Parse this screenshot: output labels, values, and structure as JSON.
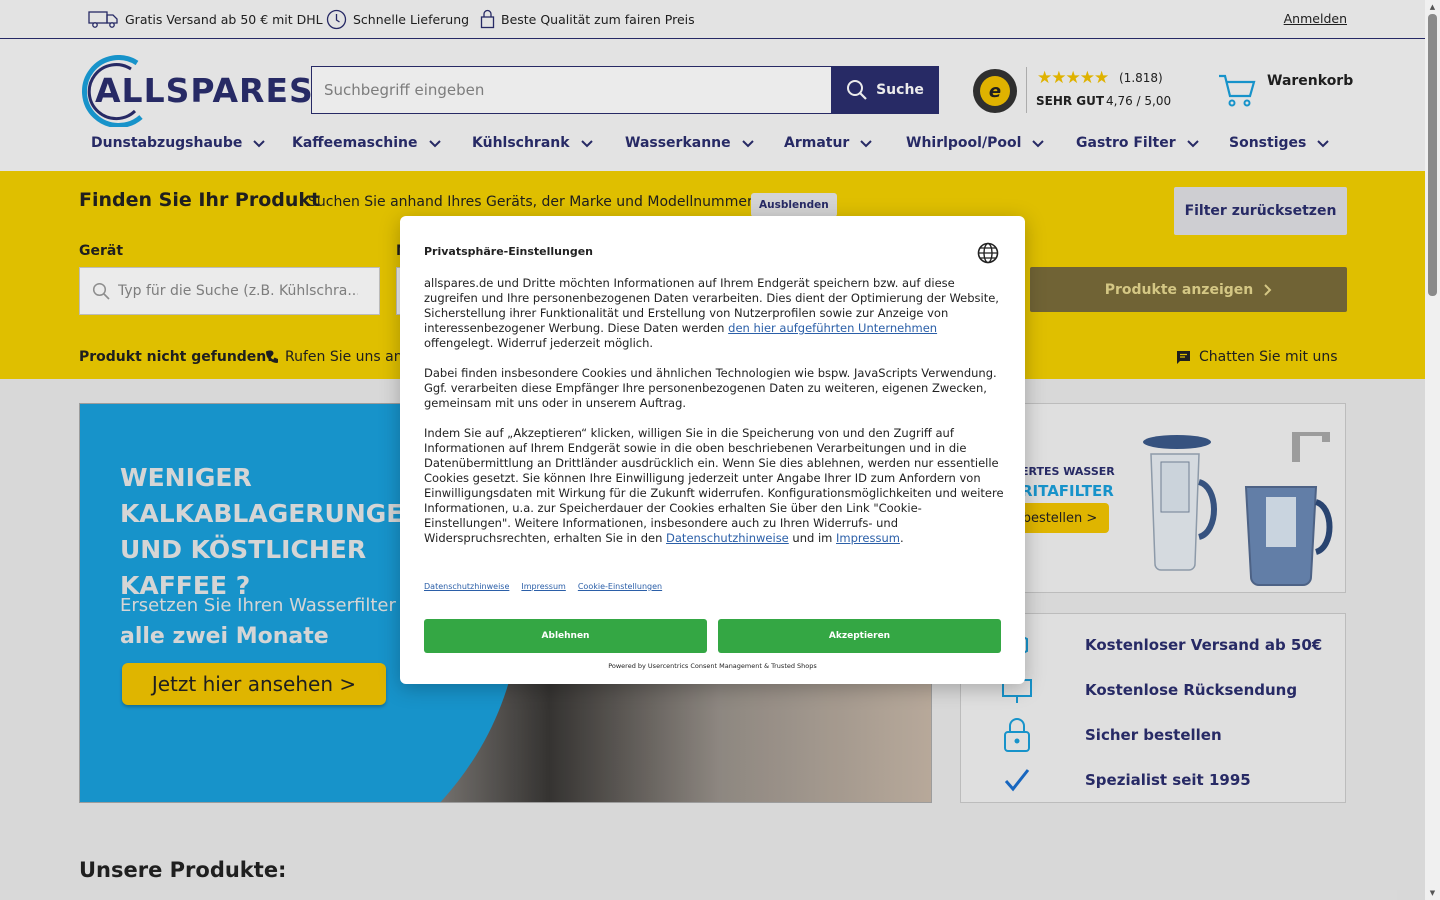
{
  "topbar": {
    "perks": [
      "Gratis Versand ab 50 € mit DHL",
      "Schnelle Lieferung",
      "Beste Qualität zum fairen Preis"
    ],
    "login": "Anmelden"
  },
  "header": {
    "logo": "ALLSPARES",
    "search_placeholder": "Suchbegriff eingeben",
    "search_button": "Suche",
    "trust": {
      "count": "(1.818)",
      "grade": "SEHR GUT",
      "score": "4,76 / 5,00",
      "rating_stars": 5
    },
    "cart": "Warenkorb"
  },
  "nav": [
    "Dunstabzugshaube",
    "Kaffeemaschine",
    "Kühlschrank",
    "Wasserkanne",
    "Armatur",
    "Whirlpool/Pool",
    "Gastro Filter",
    "Sonstiges"
  ],
  "finder": {
    "title": "Finden Sie Ihr Produkt",
    "subtitle": "Suchen Sie anhand Ihres Geräts, der Marke und Modellnummer",
    "hide": "Ausblenden",
    "reset": "Filter zurücksetzen",
    "device_label": "Gerät",
    "second_label": "M",
    "device_placeholder": "Typ für die Suche (z.B. Kühlschra...",
    "show_button": "Produkte anzeigen",
    "not_found": "Produkt nicht gefunden?",
    "call": "Rufen Sie uns an",
    "chat": "Chatten Sie mit uns"
  },
  "hero": {
    "headline": "WENIGER KALKABLAGERUNGEN UND KÖSTLICHER KAFFEE ?",
    "line2": "Ersetzen Sie Ihren Wasserfilter",
    "line3": "alle zwei Monate",
    "cta": "Jetzt hier ansehen >"
  },
  "promo": {
    "t1": "ERTES WASSER",
    "t2": "RITAFILTER",
    "button": "bestellen >"
  },
  "usp": [
    "Kostenloser Versand ab 50€",
    "Kostenlose Rücksendung",
    "Sicher bestellen",
    "Spezialist seit 1995"
  ],
  "products_title": "Unsere Produkte:",
  "consent": {
    "title": "Privatsphäre-Einstellungen",
    "p1_a": "allspares.de und Dritte möchten Informationen auf Ihrem Endgerät speichern bzw. auf diese zugreifen und Ihre personenbezogenen Daten verarbeiten. Dies dient der Optimierung der Website, Sicherstellung ihrer Funktionalität und Erstellung von Nutzerprofilen sowie zur Anzeige von interessenbezogener Werbung. Diese Daten werden ",
    "p1_link": "den hier aufgeführten Unternehmen",
    "p1_b": " offengelegt. Widerruf jederzeit möglich.",
    "p2": "Dabei finden insbesondere Cookies und ähnlichen Technologien wie bspw. JavaScripts Verwendung. Ggf. verarbeiten diese Empfänger Ihre personenbezogenen Daten zu weiteren, eigenen Zwecken, gemeinsam mit uns oder in unserem Auftrag.",
    "p3_a": "Indem Sie auf „Akzeptieren“ klicken, willigen Sie in die Speicherung von und den Zugriff auf Informationen auf Ihrem Endgerät sowie in die oben beschriebenen Verarbeitungen und in die Datenübermittlung an Drittländer ausdrücklich ein. Wenn Sie dies ablehnen, werden nur essentielle Cookies gesetzt. Sie können Ihre Einwilligung jederzeit unter Angabe Ihrer ID zum Anfordern von Einwilligungsdaten mit Wirkung für die Zukunft widerrufen. Konfigurationsmöglichkeiten und weitere Informationen, u.a. zur Speicherdauer der Cookies erhalten Sie über den Link \"Cookie-Einstellungen\". Weitere Informationen, insbesondere auch zu Ihren Widerrufs- und Widerspruchsrechten, erhalten Sie in den ",
    "p3_link1": "Datenschutzhinweise",
    "p3_mid": " und im ",
    "p3_link2": "Impressum",
    "p3_end": ".",
    "links": [
      "Datenschutzhinweise",
      "Impressum",
      "Cookie-Einstellungen"
    ],
    "decline": "Ablehnen",
    "accept": "Akzeptieren",
    "powered": "Powered by Usercentrics Consent Management & Trusted Shops"
  },
  "colors": {
    "brand": "#2b2e6e",
    "accent_yellow": "#f2d000",
    "consent_green": "#34a744",
    "link_blue": "#2b5fa8"
  }
}
